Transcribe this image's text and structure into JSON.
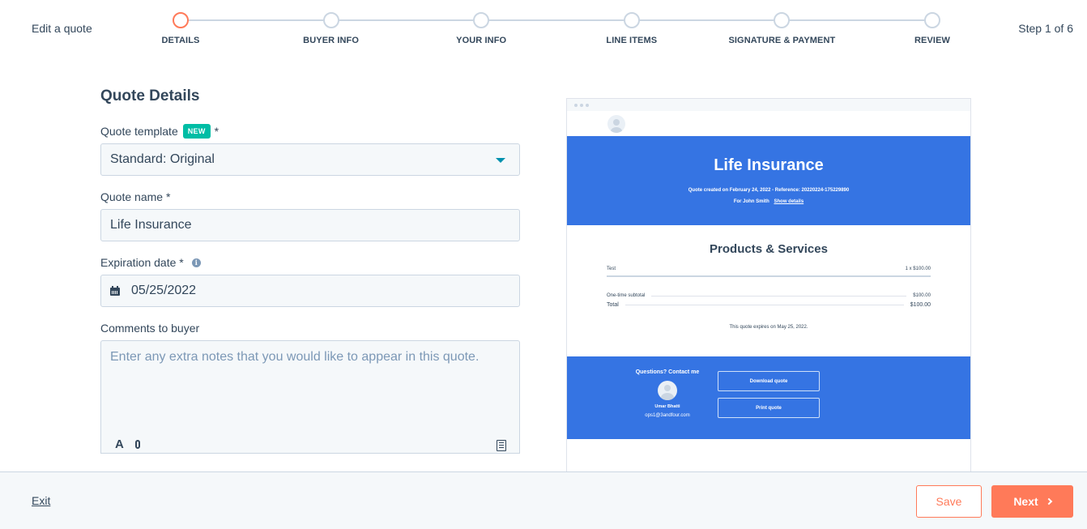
{
  "header": {
    "title": "Edit a quote",
    "step_counter": "Step 1 of 6",
    "steps": [
      {
        "label": "DETAILS",
        "active": true
      },
      {
        "label": "BUYER INFO",
        "active": false
      },
      {
        "label": "YOUR INFO",
        "active": false
      },
      {
        "label": "LINE ITEMS",
        "active": false
      },
      {
        "label": "SIGNATURE & PAYMENT",
        "active": false
      },
      {
        "label": "REVIEW",
        "active": false
      }
    ]
  },
  "form": {
    "title": "Quote Details",
    "template": {
      "label": "Quote template",
      "badge": "NEW",
      "required_mark": "*",
      "value": "Standard: Original"
    },
    "quote_name": {
      "label": "Quote name *",
      "value": "Life Insurance"
    },
    "expiration": {
      "label": "Expiration date *",
      "info_glyph": "i",
      "value": "05/25/2022"
    },
    "comments": {
      "label": "Comments to buyer",
      "placeholder": "Enter any extra notes that you would like to appear in this quote.",
      "tool_text_glyph": "A"
    }
  },
  "preview": {
    "title": "Life Insurance",
    "meta": "Quote created on February 24, 2022 - Reference: 20220224-175229890",
    "for_text": "For John Smith",
    "show_details": "Show details",
    "products_title": "Products & Services",
    "line_items": [
      {
        "name": "Test",
        "qty_price": "1 x $100.00"
      }
    ],
    "subtotal_label": "One-time subtotal",
    "subtotal_value": "$100.00",
    "total_label": "Total",
    "total_value": "$100.00",
    "expires_text": "This quote expires on May 25, 2022.",
    "contact_title": "Questions? Contact me",
    "contact_name": "Umar Bhatti",
    "contact_email": "ops1@3andfour.com",
    "download_label": "Download quote",
    "print_label": "Print quote",
    "accent_color": "#3574e3"
  },
  "footer": {
    "exit_label": "Exit",
    "save_label": "Save",
    "next_label": "Next"
  },
  "colors": {
    "primary": "#ff7a59",
    "badge": "#00bda5",
    "text": "#33475b"
  }
}
